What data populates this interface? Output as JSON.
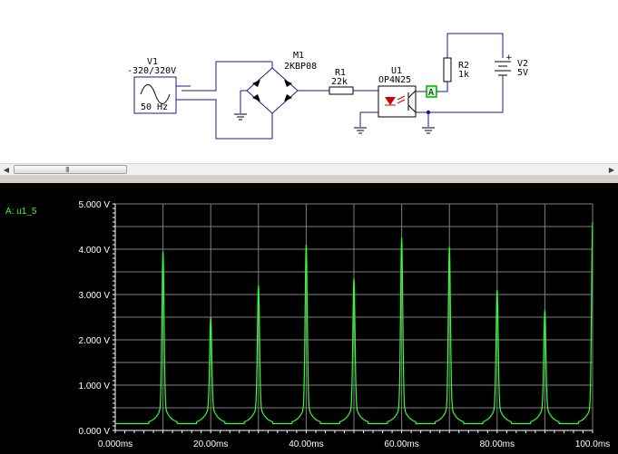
{
  "schematic": {
    "v1": {
      "ref": "V1",
      "value": "-320/320V",
      "freq": "50 Hz"
    },
    "m1": {
      "ref": "M1",
      "part": "2KBP08"
    },
    "r1": {
      "ref": "R1",
      "value": "22k"
    },
    "u1": {
      "ref": "U1",
      "part": "OP4N25"
    },
    "r2": {
      "ref": "R2",
      "value": "1k"
    },
    "v2": {
      "ref": "V2",
      "value": "5V"
    },
    "probe": {
      "label": "A"
    }
  },
  "scrollbar": {
    "grip": "III"
  },
  "grapher": {
    "trace_label": "A: u1_5",
    "background": "#000000",
    "trace_color": "#33ff33",
    "grid_color": "#808080"
  },
  "chart_data": {
    "type": "line",
    "title": "",
    "xlabel": "",
    "ylabel": "",
    "xlim": [
      0,
      100
    ],
    "ylim": [
      0,
      5
    ],
    "x_ticks": [
      0,
      20,
      40,
      60,
      80,
      100
    ],
    "y_ticks": [
      0,
      1,
      2,
      3,
      4,
      5
    ],
    "x_tick_labels": [
      "0.000ms",
      "20.00ms",
      "40.00ms",
      "60.00ms",
      "80.00ms",
      "100.0ms"
    ],
    "y_tick_labels": [
      "0.000 V",
      "1.000 V",
      "2.000 V",
      "3.000 V",
      "4.000 V",
      "5.000 V"
    ],
    "grid": true,
    "series": [
      {
        "name": "A: u1_5",
        "baseline": 0.15,
        "pulses": [
          {
            "t": 10,
            "peak": 3.45
          },
          {
            "t": 20,
            "peak": 2.0
          },
          {
            "t": 30,
            "peak": 2.7
          },
          {
            "t": 40,
            "peak": 3.6
          },
          {
            "t": 50,
            "peak": 2.85
          },
          {
            "t": 60,
            "peak": 3.75
          },
          {
            "t": 70,
            "peak": 3.55
          },
          {
            "t": 80,
            "peak": 2.6
          },
          {
            "t": 90,
            "peak": 2.15
          },
          {
            "t": 100,
            "peak": 4.1
          }
        ]
      }
    ]
  }
}
